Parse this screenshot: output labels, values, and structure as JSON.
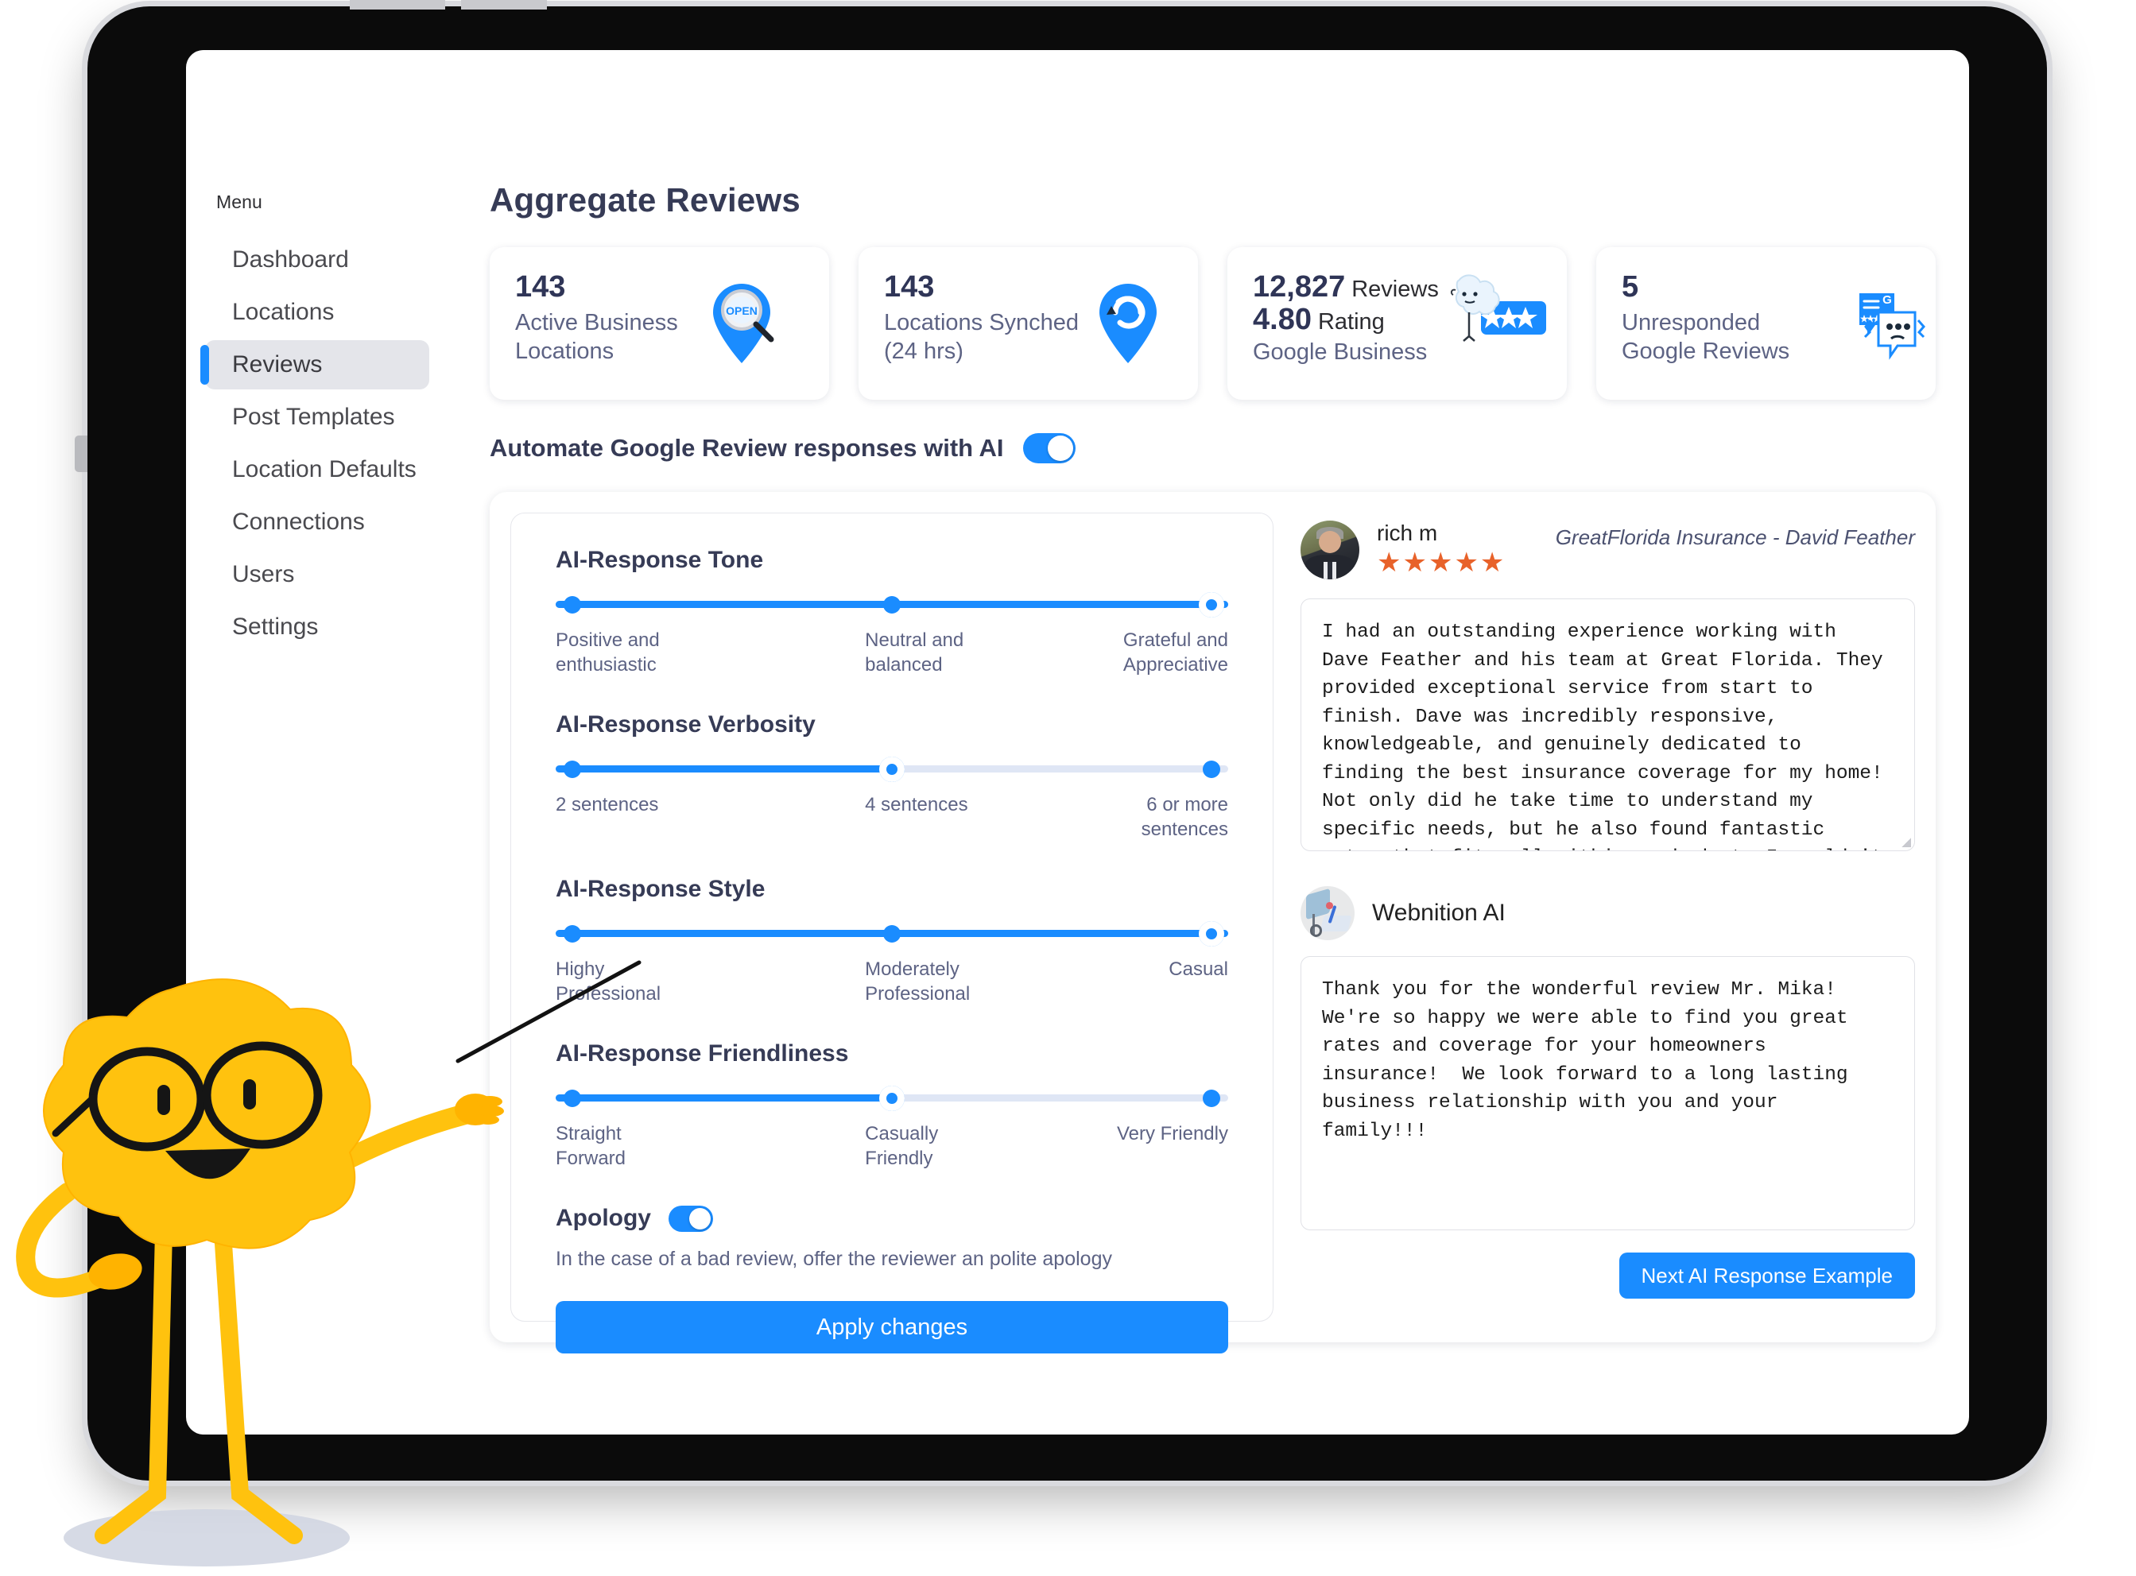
{
  "sidebar": {
    "menu_label": "Menu",
    "items": [
      {
        "label": "Dashboard",
        "active": false
      },
      {
        "label": "Locations",
        "active": false
      },
      {
        "label": "Reviews",
        "active": true
      },
      {
        "label": "Post Templates",
        "active": false
      },
      {
        "label": "Location Defaults",
        "active": false
      },
      {
        "label": "Connections",
        "active": false
      },
      {
        "label": "Users",
        "active": false
      },
      {
        "label": "Settings",
        "active": false
      }
    ]
  },
  "page": {
    "title": "Aggregate Reviews"
  },
  "stats": [
    {
      "number": "143",
      "unit": "",
      "label": "Active Business Locations",
      "sub": "",
      "icon": "map-pin-open-icon"
    },
    {
      "number": "143",
      "unit": "",
      "label": "Locations Synched (24 hrs)",
      "sub": "",
      "icon": "map-pin-sync-icon"
    },
    {
      "number": "12,827",
      "unit": "Reviews",
      "number2": "4.80",
      "unit2": "Rating",
      "label": "",
      "sub": "Google Business",
      "icon": "star-mascot-rating-icon"
    },
    {
      "number": "5",
      "unit": "",
      "label": "Unresponded Google Reviews",
      "sub": "",
      "icon": "google-review-chat-icon"
    }
  ],
  "automate": {
    "label": "Automate Google Review responses with AI",
    "enabled": true
  },
  "settings": {
    "sliders": [
      {
        "title": "AI-Response Tone",
        "value": 2,
        "labels": [
          "Positive and\nenthusiastic",
          "Neutral and\nbalanced",
          "Grateful and\nAppreciative"
        ]
      },
      {
        "title": "AI-Response Verbosity",
        "value": 1,
        "labels": [
          "2 sentences",
          "4 sentences",
          "6 or more\nsentences"
        ]
      },
      {
        "title": "AI-Response Style",
        "value": 2,
        "labels": [
          "Highy\nProfessional",
          "Moderately\nProfessional",
          "Casual"
        ]
      },
      {
        "title": "AI-Response Friendliness",
        "value": 1,
        "labels": [
          "Straight\nForward",
          "Casually\nFriendly",
          "Very Friendly"
        ]
      }
    ],
    "apology": {
      "label": "Apology",
      "enabled": true,
      "description": "In the case of a bad review, offer the reviewer an polite apology"
    },
    "apply_label": "Apply changes"
  },
  "review": {
    "reviewer_name": "rich m",
    "stars": "★★★★★",
    "star_count": 5,
    "business": "GreatFlorida Insurance - David Feather",
    "text": "I had an outstanding experience working with Dave Feather and his team at Great Florida. They provided exceptional service from start to finish. Dave was incredibly responsive, knowledgeable, and genuinely dedicated to finding the best insurance coverage for my home! Not only did he take time to understand my specific needs, but he also found fantastic rates that fit well within my budget. I couldn't be happier and highly recommend others to choose Dave and his team for their honeowner insurance too!"
  },
  "ai_response": {
    "name": "Webnition AI",
    "text": "Thank you for the wonderful review Mr. Mika!  We're so happy we were able to find you great rates and coverage for your homeowners insurance!  We look forward to a long lasting business relationship with you and your family!!!",
    "next_button": "Next AI Response Example"
  },
  "colors": {
    "accent": "#1a8cff",
    "title": "#363b56",
    "muted": "#5d6384",
    "star": "#e8622a",
    "mascot": "#ffc20e"
  }
}
